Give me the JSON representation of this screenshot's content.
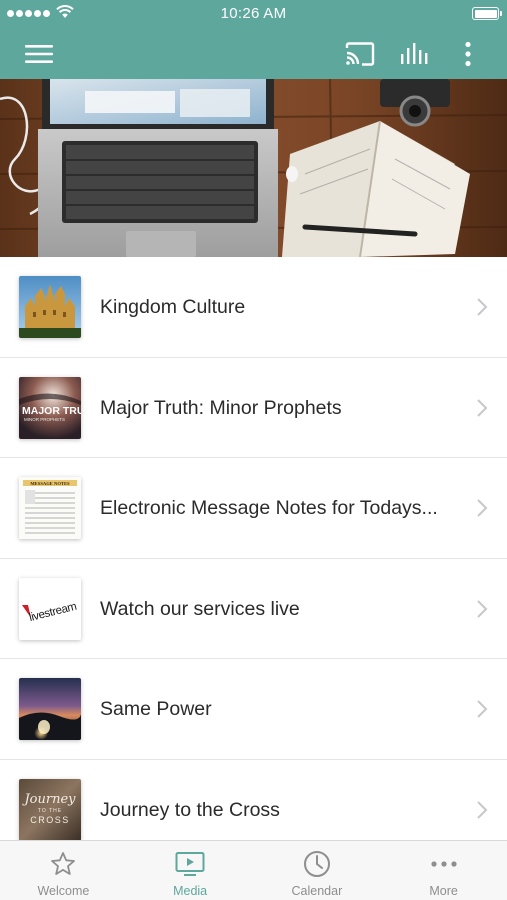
{
  "status_bar": {
    "time": "10:26 AM"
  },
  "nav": {
    "menu_icon": "hamburger-menu-icon",
    "cast_icon": "cast-icon",
    "audio_icon": "audio-bars-icon",
    "more_icon": "vertical-ellipsis-icon",
    "accent": "#5ea79c"
  },
  "hero": {
    "description_icon": "laptop-notebook-desk-photo"
  },
  "media_items": [
    {
      "label": "Kingdom Culture"
    },
    {
      "label": "Major Truth: Minor Prophets",
      "thumb_text_1": "MAJOR TRUTH",
      "thumb_text_2": "MINOR PROPHETS"
    },
    {
      "label": "Electronic Message Notes for Todays...",
      "thumb_text_1": "MESSAGE NOTES"
    },
    {
      "label": "Watch our services live",
      "thumb_text_1": "livestream"
    },
    {
      "label": "Same Power"
    },
    {
      "label": "Journey to the Cross",
      "thumb_text_1": "Journey",
      "thumb_text_2": "TO THE",
      "thumb_text_3": "CROSS"
    }
  ],
  "tabs": [
    {
      "label": "Welcome",
      "icon": "star-icon",
      "active": false
    },
    {
      "label": "Media",
      "icon": "tv-play-icon",
      "active": true
    },
    {
      "label": "Calendar",
      "icon": "clock-icon",
      "active": false
    },
    {
      "label": "More",
      "icon": "horizontal-ellipsis-icon",
      "active": false
    }
  ]
}
